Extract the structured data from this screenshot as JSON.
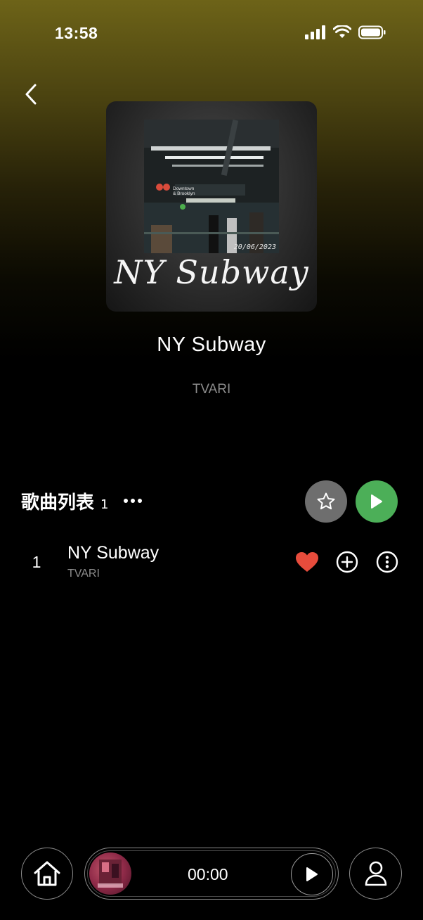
{
  "status_bar": {
    "time": "13:58"
  },
  "album": {
    "cover_script_text": "NY Subway",
    "cover_date": "20/06/2023",
    "cover_sign_line1": "Downtown",
    "cover_sign_line2": "& Brooklyn",
    "title": "NY Subway",
    "artist": "TVARI"
  },
  "song_list": {
    "heading": "歌曲列表",
    "count": "1",
    "tracks": [
      {
        "number": "1",
        "title": "NY Subway",
        "artist": "TVARI",
        "liked": true
      }
    ]
  },
  "mini_player": {
    "time": "00:00"
  },
  "colors": {
    "accent_green": "#4caf58",
    "heart_red": "#e74c3c",
    "header_gradient_top": "#6d6318"
  },
  "icons": [
    "back-icon",
    "star-icon",
    "play-icon",
    "heart-icon",
    "add-circle-icon",
    "more-vertical-icon",
    "home-icon",
    "user-icon",
    "more-horizontal-icon"
  ]
}
